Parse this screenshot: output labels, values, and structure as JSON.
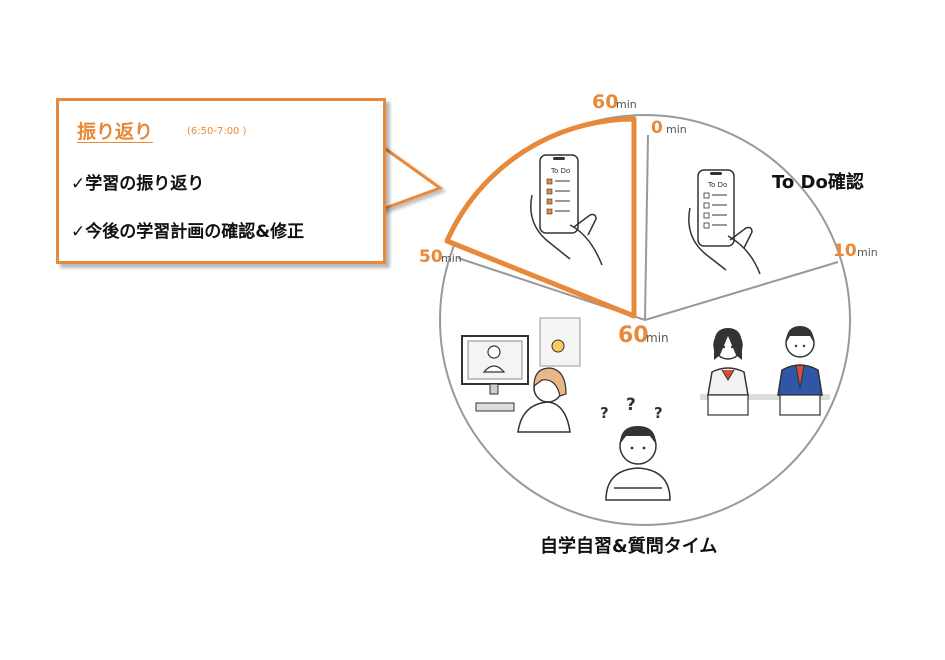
{
  "callout": {
    "title": "振り返り",
    "time": "(6:50-7:00 )",
    "item1": "✓学習の振り返り",
    "item2": "✓今後の学習計画の確認&修正"
  },
  "segments": {
    "todo": "To Do確認",
    "self_study": "自学自習&質問タイム"
  },
  "ticks": {
    "t0": {
      "num": "0",
      "unit": "min"
    },
    "t10": {
      "num": "10",
      "unit": "min"
    },
    "t50": {
      "num": "50",
      "unit": "min"
    },
    "t60_top": {
      "num": "60",
      "unit": "min"
    },
    "t60_center": {
      "num": "60",
      "unit": "min"
    }
  },
  "phone": {
    "screen_title": "To Do"
  },
  "icons": {
    "phone_left": "smartphone-todo-icon",
    "phone_right": "smartphone-todo-icon",
    "students": "students-studying-icon",
    "thinker": "confused-student-icon",
    "online": "online-lesson-icon"
  },
  "colors": {
    "accent": "#e8893a",
    "line": "#999999"
  }
}
